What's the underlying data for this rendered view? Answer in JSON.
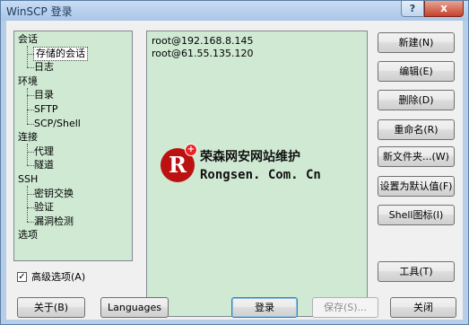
{
  "window": {
    "title": "WinSCP 登录",
    "help_icon": "?",
    "close_icon": "x"
  },
  "tree": {
    "items": [
      {
        "label": "会话",
        "level": 0,
        "selected": false
      },
      {
        "label": "存储的会话",
        "level": 1,
        "selected": true
      },
      {
        "label": "日志",
        "level": 1,
        "selected": false
      },
      {
        "label": "环境",
        "level": 0,
        "selected": false
      },
      {
        "label": "目录",
        "level": 1,
        "selected": false
      },
      {
        "label": "SFTP",
        "level": 1,
        "selected": false
      },
      {
        "label": "SCP/Shell",
        "level": 1,
        "selected": false
      },
      {
        "label": "连接",
        "level": 0,
        "selected": false
      },
      {
        "label": "代理",
        "level": 1,
        "selected": false
      },
      {
        "label": "隧道",
        "level": 1,
        "selected": false
      },
      {
        "label": "SSH",
        "level": 0,
        "selected": false
      },
      {
        "label": "密钥交换",
        "level": 1,
        "selected": false
      },
      {
        "label": "验证",
        "level": 1,
        "selected": false
      },
      {
        "label": "漏洞检测",
        "level": 1,
        "selected": false
      },
      {
        "label": "选项",
        "level": 0,
        "selected": false
      }
    ]
  },
  "sessions": [
    "root@192.168.8.145",
    "root@61.55.135.120"
  ],
  "watermark": {
    "logo_letter": "R",
    "logo_plus": "+",
    "cn": "荣森网安网站维护",
    "en": "Rongsen. Com. Cn"
  },
  "side_buttons": {
    "new": "新建(N)",
    "edit": "编辑(E)",
    "delete": "删除(D)",
    "rename": "重命名(R)",
    "new_folder": "新文件夹...(W)",
    "set_default": "设置为默认值(F)",
    "shell_icon": "Shell图标(I)",
    "tools": "工具(T)"
  },
  "advanced": {
    "label": "高级选项(A)",
    "checked": true,
    "check_mark": "✓"
  },
  "bottom_buttons": {
    "about": "关于(B)",
    "languages": "Languages",
    "login": "登录",
    "save": "保存(S)...",
    "close": "关闭"
  }
}
